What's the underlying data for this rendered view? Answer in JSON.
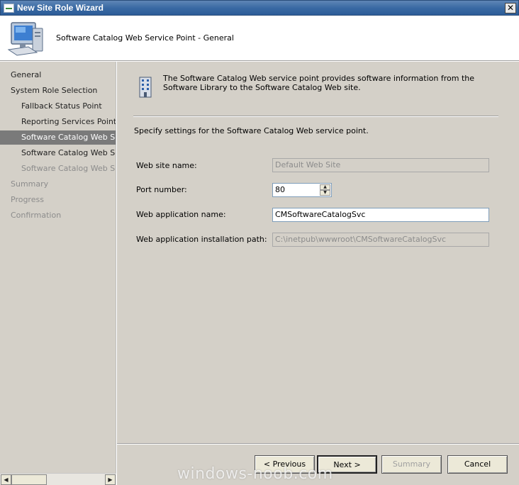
{
  "window": {
    "title": "New Site Role Wizard",
    "close_glyph": "✕"
  },
  "header": {
    "title": "Software Catalog Web Service Point - General",
    "icon": "computer-icon"
  },
  "sidebar": {
    "items": [
      {
        "label": "General",
        "state": "normal"
      },
      {
        "label": "System Role Selection",
        "state": "normal"
      },
      {
        "label": "Fallback Status Point",
        "state": "normal"
      },
      {
        "label": "Reporting Services Point",
        "state": "normal"
      },
      {
        "label": "Software Catalog Web Service Point",
        "state": "active"
      },
      {
        "label": "Software Catalog Web Service Point",
        "state": "normal"
      },
      {
        "label": "Software Catalog Web Site Point",
        "state": "disabled"
      },
      {
        "label": "Summary",
        "state": "disabled"
      },
      {
        "label": "Progress",
        "state": "disabled"
      },
      {
        "label": "Confirmation",
        "state": "disabled"
      }
    ]
  },
  "main": {
    "info_text": "The Software Catalog Web service point provides software information from the Software Library to the Software Catalog Web site.",
    "info_icon": "building-icon",
    "specify": "Specify settings for the Software Catalog Web service point.",
    "fields": {
      "website_name": {
        "label": "Web site name:",
        "value": "Default Web Site",
        "enabled": false
      },
      "port_number": {
        "label": "Port number:",
        "value": "80"
      },
      "app_name": {
        "label": "Web application name:",
        "value": "CMSoftwareCatalogSvc",
        "enabled": true
      },
      "install_path": {
        "label": "Web application installation path:",
        "value": "C:\\inetpub\\wwwroot\\CMSoftwareCatalogSvc",
        "enabled": false
      }
    }
  },
  "buttons": {
    "previous": "< Previous",
    "next": "Next >",
    "summary": "Summary",
    "cancel": "Cancel"
  },
  "scrollbar": {
    "left": "◀",
    "right": "▶"
  },
  "spinner": {
    "up": "▲",
    "down": "▼"
  },
  "watermark": "windows-noob.com"
}
